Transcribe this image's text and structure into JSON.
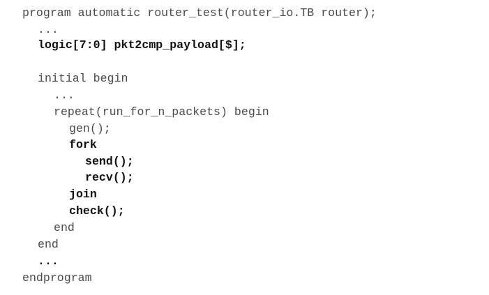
{
  "code_lines": [
    {
      "text": "program automatic router_test(router_io.TB router);",
      "bold": false
    },
    {
      "text": "...",
      "bold": false
    },
    {
      "text": "logic[7:0] pkt2cmp_payload[$];",
      "bold": true
    },
    {
      "text": "initial begin",
      "bold": false
    },
    {
      "text": "...",
      "bold": false
    },
    {
      "text": "repeat(run_for_n_packets) begin",
      "bold": false
    },
    {
      "text": "gen();",
      "bold": false
    },
    {
      "text": "fork",
      "bold": true
    },
    {
      "text": "send();",
      "bold": true
    },
    {
      "text": "recv();",
      "bold": true
    },
    {
      "text": "join",
      "bold": true
    },
    {
      "text": "check();",
      "bold": true
    },
    {
      "text": "end",
      "bold": false
    },
    {
      "text": "end",
      "bold": false
    },
    {
      "text": "...",
      "bold": true
    },
    {
      "text": "endprogram",
      "bold": false
    }
  ]
}
